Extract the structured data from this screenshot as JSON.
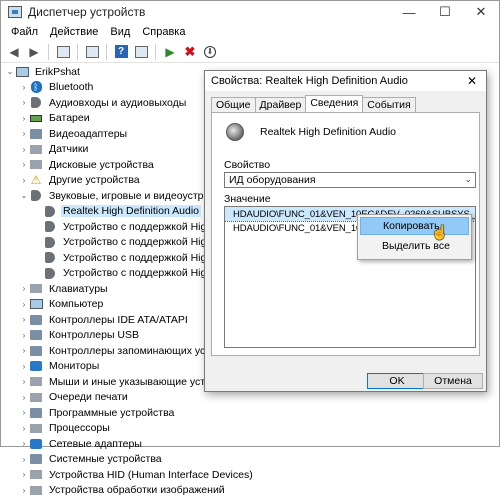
{
  "window": {
    "title": "Диспетчер устройств",
    "minimize": "—",
    "maximize": "☐",
    "close": "✕"
  },
  "menu": [
    "Файл",
    "Действие",
    "Вид",
    "Справка"
  ],
  "toolbar": {
    "back": "◀",
    "forward": "▶",
    "help": "?",
    "enable": "▶",
    "disable": "✖",
    "update": "⬇"
  },
  "tree": {
    "root": "ErikPshat",
    "items": [
      {
        "label": "Bluetooth",
        "icon": "bluetooth-icon",
        "exp": "›"
      },
      {
        "label": "Аудиовходы и аудиовыходы",
        "icon": "audio-io-icon",
        "exp": "›"
      },
      {
        "label": "Батареи",
        "icon": "battery-icon",
        "exp": "›"
      },
      {
        "label": "Видеоадаптеры",
        "icon": "display-adapter-icon",
        "exp": "›"
      },
      {
        "label": "Датчики",
        "icon": "sensor-icon",
        "exp": "›"
      },
      {
        "label": "Дисковые устройства",
        "icon": "disk-icon",
        "exp": "›"
      },
      {
        "label": "Другие устройства",
        "icon": "other-devices-icon",
        "exp": "›"
      },
      {
        "label": "Звуковые, игровые и видеоустройства",
        "icon": "sound-icon",
        "exp": "⌄"
      }
    ],
    "sound_children": [
      "Realtek High Definition Audio",
      "Устройство с поддержкой High Defin",
      "Устройство с поддержкой High Defin",
      "Устройство с поддержкой High Defin",
      "Устройство с поддержкой High Defin"
    ],
    "after": [
      "Клавиатуры",
      "Компьютер",
      "Контроллеры IDE ATA/ATAPI",
      "Контроллеры USB",
      "Контроллеры запоминающих устройст",
      "Мониторы",
      "Мыши и иные указывающие устройств",
      "Очереди печати",
      "Программные устройства",
      "Процессоры",
      "Сетевые адаптеры",
      "Системные устройства",
      "Устройства HID (Human Interface Devices)",
      "Устройства обработки изображений"
    ]
  },
  "dialog": {
    "title": "Свойства: Realtek High Definition Audio",
    "close": "✕",
    "tabs": [
      "Общие",
      "Драйвер",
      "Сведения",
      "События"
    ],
    "device_name": "Realtek High Definition Audio",
    "property_label": "Свойство",
    "property_value": "ИД оборудования",
    "value_label": "Значение",
    "values": [
      "HDAUDIO\\FUNC_01&VEN_10EC&DEV_0269&SUBSYS_1043841C&REV",
      "HDAUDIO\\FUNC_01&VEN_10EC&DE"
    ],
    "context_menu": [
      "Копировать",
      "Выделить все"
    ],
    "ok": "OK",
    "cancel": "Отмена"
  }
}
